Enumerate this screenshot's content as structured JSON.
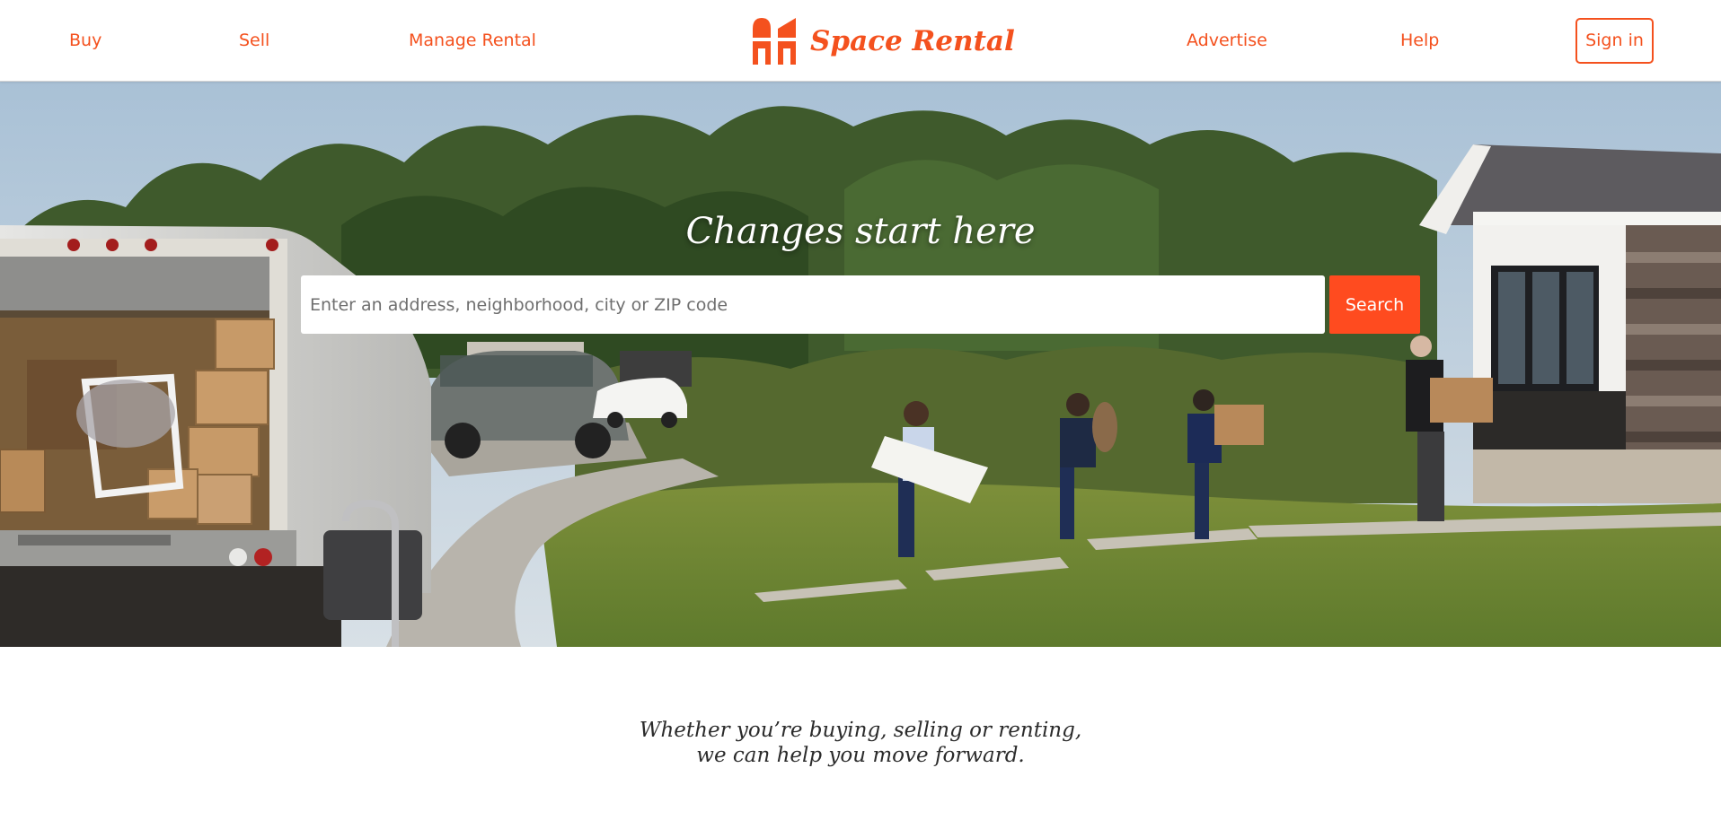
{
  "header": {
    "nav_left": [
      "Buy",
      "Sell",
      "Manage Rental"
    ],
    "brand": "Space Rental",
    "nav_right": [
      "Advertise",
      "Help"
    ],
    "sign_in": "Sign in"
  },
  "hero": {
    "title": "Changes start here",
    "search_placeholder": "Enter an address, neighborhood, city or ZIP code",
    "search_button": "Search"
  },
  "tagline": {
    "line1": "Whether you’re buying, selling or renting,",
    "line2": "we can help you move forward."
  },
  "colors": {
    "accent": "#f4511e",
    "search_button": "#ff4b1f"
  }
}
